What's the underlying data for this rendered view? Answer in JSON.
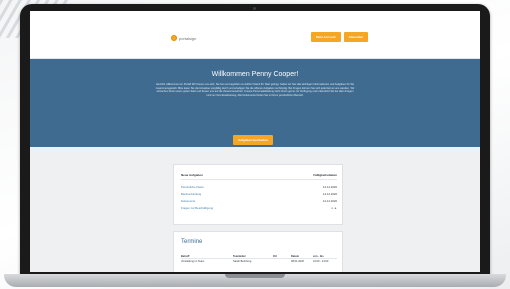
{
  "header": {
    "logo_text": "portalsign",
    "buttons": [
      "Mein Account",
      "Abmelden"
    ]
  },
  "hero": {
    "title": "Willkommen Penny Cooper!",
    "paragraph": "Herzlich willkommen im Portal! Wir freuen uns sehr, Sie bei uns begrüßen zu dürfen! Damit Ihr Start gelingt, haben wir hier alle wichtigen Informationen und Aufgaben für Sie zusammengestellt. Bitte lesen Sie die Hinweise sorgfältig durch und erledigen Sie die offenen Aufgaben rechtzeitig. Bei Fragen können Sie sich jederzeit an uns wenden. Wir wünschen Ihnen einen guten Start und freuen uns auf die Zusammenarbeit. Unsere Personalabteilung steht Ihnen gerne zur Verfügung und unterstützt Sie bei allen Fragen rund um Ihre Einarbeitung. Alle Dokumente finden Sie in Ihrem persönlichen Bereich.",
    "button": "Aufgaben bearbeiten"
  },
  "tasks": {
    "col_task": "Neue Aufgaben",
    "col_due": "Fälligkeitsdatum",
    "rows": [
      {
        "label": "Persönliche Daten",
        "date": "14.12.2020"
      },
      {
        "label": "Bankverbindung",
        "date": "14.12.2020"
      },
      {
        "label": "Dokumente",
        "date": "14.12.2020"
      },
      {
        "label": "Fragen zur Beschäftigung",
        "date": "n. a."
      }
    ]
  },
  "appointments": {
    "title": "Termine",
    "columns": [
      "Betreff",
      "Teamleiter",
      "Ort",
      "Datum",
      "von - bis"
    ],
    "rows": [
      [
        "Vorstellung im Team",
        "Sarah Bernburg",
        "",
        "08.01.2020",
        "10:00 - 14:00"
      ]
    ]
  },
  "colors": {
    "accent": "#f5a623",
    "hero_blue": "#3f6b91",
    "link_blue": "#3f7fae"
  }
}
